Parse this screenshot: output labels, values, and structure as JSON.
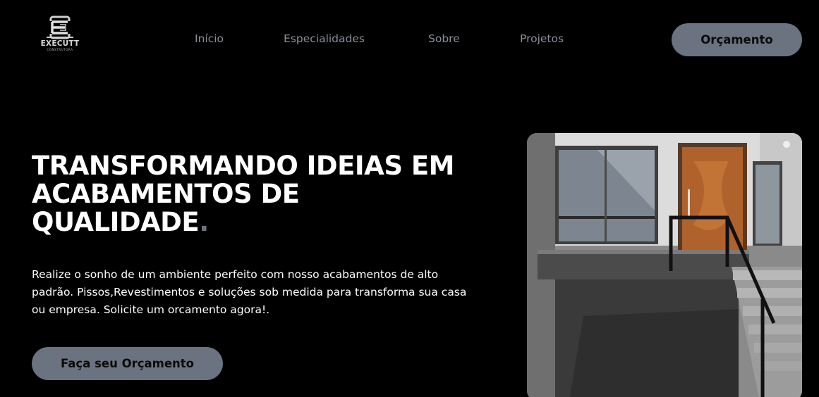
{
  "brand": {
    "name": "EXECUTT",
    "tagline": "CONSTRUTORA",
    "logo_icon": "ec-monogram-icon"
  },
  "nav": {
    "items": [
      "Início",
      "Especialidades",
      "Sobre",
      "Projetos"
    ],
    "cta_label": "Orçamento"
  },
  "hero": {
    "title_line1": "TRANSFORMANDO IDEIAS EM",
    "title_line2": "ACABAMENTOS DE",
    "title_line3": "QUALIDADE",
    "title_dot": ".",
    "description": "Realize o sonho de um ambiente perfeito com nosso acabamentos de alto padrão. Pissos,Revestimentos e soluções sob medida para transforma sua casa ou empresa. Solicite um orcamento agora!.",
    "cta_label": "Faça seu Orçamento",
    "image_subject": "house-entrance-with-stairs-photo"
  },
  "colors": {
    "background": "#000000",
    "accent": "#6b7280",
    "text": "#ffffff",
    "nav_text": "#8b8f98"
  }
}
